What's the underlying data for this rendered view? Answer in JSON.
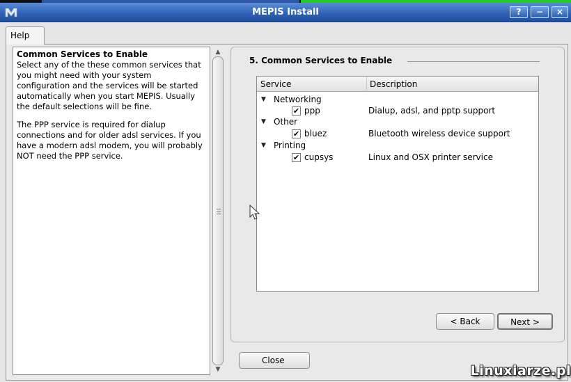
{
  "window": {
    "title": "MEPIS Install",
    "help_button": "?",
    "minimize_button": "−",
    "close_button": "×"
  },
  "tabs": [
    {
      "label": "Help"
    }
  ],
  "help": {
    "heading": "Common Services to Enable",
    "para1": "Select any of the these common services that you might need with your system configuration and the services will be started automatically when you start MEPIS. Usually the default selections will be fine.",
    "para2": "The PPP service is required for dialup connections and for older adsl services. If you have a modern adsl modem, you will probably NOT need the PPP service."
  },
  "section": {
    "title": "5. Common Services to Enable"
  },
  "tree": {
    "columns": [
      "Service",
      "Description"
    ],
    "groups": [
      {
        "label": "Networking",
        "items": [
          {
            "name": "ppp",
            "description": "Dialup, adsl, and pptp support",
            "checked": true
          }
        ]
      },
      {
        "label": "Other",
        "items": [
          {
            "name": "bluez",
            "description": "Bluetooth wireless device support",
            "checked": true
          }
        ]
      },
      {
        "label": "Printing",
        "items": [
          {
            "name": "cupsys",
            "description": "Linux and OSX printer service",
            "checked": true
          }
        ]
      }
    ]
  },
  "buttons": {
    "back": "< Back",
    "next": "Next >",
    "close": "Close"
  },
  "watermark": "Linuxiarze.pl",
  "colors": {
    "titlebar": "#2f63b8",
    "accent_green": "#22cc22"
  }
}
